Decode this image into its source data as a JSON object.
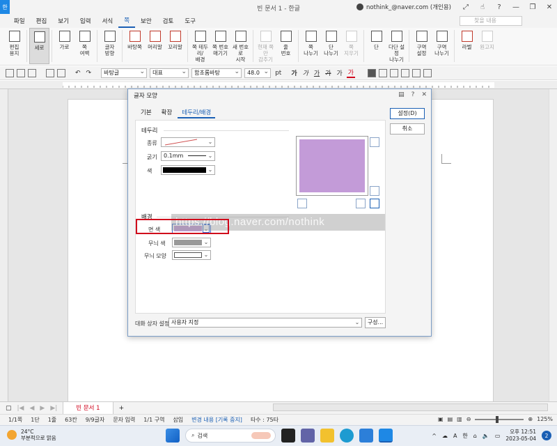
{
  "window": {
    "title": "빈 문서 1 - 한글",
    "app_icon": "한",
    "account": "nothink_@naver.com (개인용)"
  },
  "menu": {
    "items": [
      "파일",
      "편집",
      "보기",
      "입력",
      "서식",
      "쪽",
      "보안",
      "검토",
      "도구"
    ],
    "active_index": 5,
    "search_placeholder": "찾을 내용"
  },
  "ribbon": {
    "buttons": [
      {
        "label": "편집\n용지",
        "icon": "page-setup-icon"
      },
      {
        "label": "세로",
        "icon": "portrait-icon",
        "selected": true
      },
      {
        "label": "가로",
        "icon": "landscape-icon"
      },
      {
        "label": "쪽\n여백",
        "icon": "margin-icon"
      },
      {
        "label": "글자\n방향",
        "icon": "text-direction-icon"
      },
      {
        "label": "바탕쪽",
        "icon": "master-page-icon",
        "red": true
      },
      {
        "label": "머리말",
        "icon": "header-icon",
        "red": true
      },
      {
        "label": "꼬리말",
        "icon": "footer-icon",
        "red": true
      },
      {
        "label": "쪽 테두리/\n배경",
        "icon": "page-border-icon"
      },
      {
        "label": "쪽 번호\n매기기",
        "icon": "page-number-icon"
      },
      {
        "label": "새 번호로\n시작",
        "icon": "new-number-icon"
      },
      {
        "label": "현재 쪽만\n감추기",
        "icon": "hide-icon",
        "disabled": true
      },
      {
        "label": "줄\n번호",
        "icon": "line-number-icon"
      },
      {
        "label": "쪽\n나누기",
        "icon": "page-break-icon"
      },
      {
        "label": "단\n나누기",
        "icon": "column-break-icon"
      },
      {
        "label": "쪽\n지우기",
        "icon": "delete-page-icon",
        "disabled": true
      },
      {
        "label": "단",
        "icon": "columns-icon"
      },
      {
        "label": "다단 설정\n나누기",
        "icon": "multi-column-icon"
      },
      {
        "label": "구역\n설정",
        "icon": "section-setup-icon"
      },
      {
        "label": "구역\n나누기",
        "icon": "section-break-icon"
      },
      {
        "label": "라벨",
        "icon": "label-icon",
        "red": true
      },
      {
        "label": "원고지",
        "icon": "manuscript-icon",
        "disabled": true
      }
    ]
  },
  "toolbar": {
    "style": "바탕글",
    "lang": "대표",
    "font": "함초롬바탕",
    "size": "48.0",
    "unit": "pt",
    "glyphs": [
      "가",
      "가",
      "가",
      "가",
      "가",
      "가"
    ]
  },
  "doc_tab": "빈 문서 1",
  "status": {
    "page": "1/1쪽",
    "section": "1단",
    "line": "1줄",
    "col": "63칸",
    "chars": "9/9글자",
    "mode": "문자 입력",
    "area": "1/1 구역",
    "insert": "삽입",
    "track": "변경 내용 [기록 중지]",
    "typing": "타수 : 75타",
    "zoom": "125%"
  },
  "taskbar": {
    "temp": "24°C",
    "weather": "부분적으로 맑음",
    "search": "검색",
    "ime": "A",
    "ime2": "한",
    "time": "오후 12:51",
    "date": "2023-05-04",
    "notifications": "2"
  },
  "dialog": {
    "title": "글자 모양",
    "tabs": [
      "기본",
      "확장",
      "테두리/배경"
    ],
    "active_tab": 2,
    "border_group": "테두리",
    "type_label": "종류",
    "thickness_label": "굵기",
    "thickness_value": "0.1mm",
    "color_label": "색",
    "border_color": "#000000",
    "background_group": "배경",
    "face_color_label": "면 색",
    "pattern_color_label": "무늬 색",
    "pattern_shape_label": "무늬 모양",
    "pattern_color": "#999999",
    "preview_color": "#c39bd8",
    "ok_button": "설정(D)",
    "cancel_button": "취소",
    "dialog_setting_label": "대화 상자 설정",
    "dialog_setting_value": "사용자 지정",
    "config_button": "구성..."
  },
  "watermark": "https://blog.naver.com/nothink"
}
